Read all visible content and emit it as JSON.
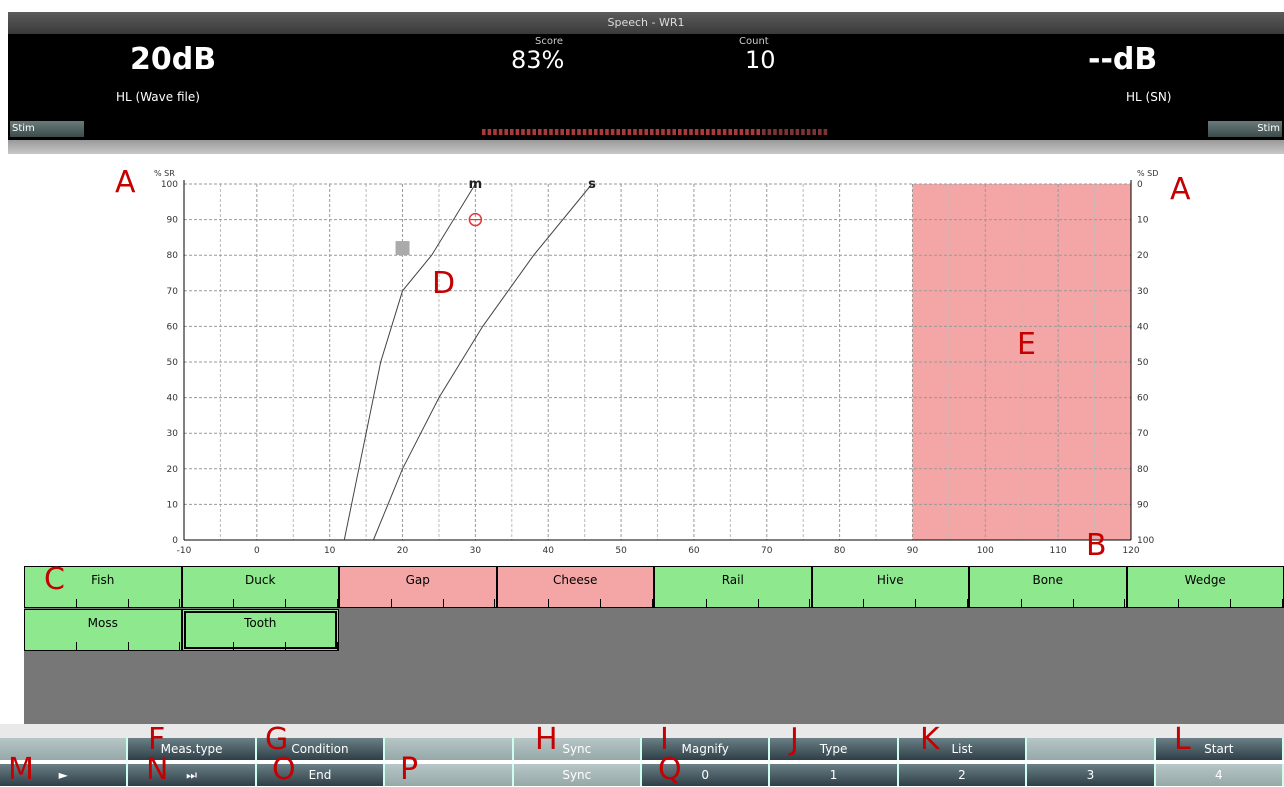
{
  "window": {
    "title": "Speech - WR1"
  },
  "header": {
    "left_level": "20dB",
    "left_sub": "HL (Wave file)",
    "score_label": "Score",
    "score_value": "83%",
    "count_label": "Count",
    "count_value": "10",
    "right_level": "--dB",
    "right_sub": "HL (SN)",
    "stim_left": "Stim",
    "stim_right": "Stim"
  },
  "chart_data": {
    "type": "line",
    "ylabel_left": "% SR",
    "ylabel_right": "% SD",
    "xlim": [
      -10,
      120
    ],
    "ylim": [
      0,
      100
    ],
    "x_ticks": [
      -10,
      0,
      10,
      20,
      30,
      40,
      50,
      60,
      70,
      80,
      90,
      100,
      110,
      120
    ],
    "y_ticks_left": [
      0,
      10,
      20,
      30,
      40,
      50,
      60,
      70,
      80,
      90,
      100
    ],
    "y_ticks_right": [
      100,
      90,
      80,
      70,
      60,
      50,
      40,
      30,
      20,
      10,
      0
    ],
    "grid": true,
    "series": [
      {
        "name": "m",
        "x": [
          12,
          14,
          17,
          20,
          24,
          30
        ],
        "y": [
          0,
          20,
          50,
          70,
          80,
          100
        ]
      },
      {
        "name": "s",
        "x": [
          16,
          20,
          25,
          31,
          38,
          46
        ],
        "y": [
          0,
          20,
          40,
          60,
          80,
          100
        ]
      }
    ],
    "points": [
      {
        "symbol": "circle",
        "x": 30,
        "y": 90,
        "color": "#e23a3a"
      },
      {
        "symbol": "square",
        "x": 20,
        "y": 82,
        "color": "#aaaaaa"
      }
    ],
    "shaded_region": {
      "x": [
        90,
        120
      ],
      "y": [
        0,
        100
      ],
      "color": "#f4a6a6"
    }
  },
  "annotations": {
    "A": "A",
    "B": "B",
    "C": "C",
    "D": "D",
    "E": "E",
    "F": "F",
    "G": "G",
    "H": "H",
    "I": "I",
    "J": "J",
    "K": "K",
    "L": "L",
    "M": "M",
    "N": "N",
    "O": "O",
    "P": "P",
    "Q": "Q"
  },
  "words": [
    {
      "label": "Fish",
      "state": "green"
    },
    {
      "label": "Duck",
      "state": "green"
    },
    {
      "label": "Gap",
      "state": "pink"
    },
    {
      "label": "Cheese",
      "state": "pink"
    },
    {
      "label": "Rail",
      "state": "green"
    },
    {
      "label": "Hive",
      "state": "green"
    },
    {
      "label": "Bone",
      "state": "green"
    },
    {
      "label": "Wedge",
      "state": "green"
    },
    {
      "label": "Moss",
      "state": "green"
    },
    {
      "label": "Tooth",
      "state": "green"
    }
  ],
  "fkeys_top": [
    "",
    "Meas.type",
    "Condition",
    "",
    "Sync",
    "Magnify",
    "Type",
    "List",
    "",
    "Start"
  ],
  "fkeys_bottom": [
    "►",
    "⏭",
    "End",
    "",
    "Sync",
    "0",
    "1",
    "2",
    "3",
    "4"
  ]
}
